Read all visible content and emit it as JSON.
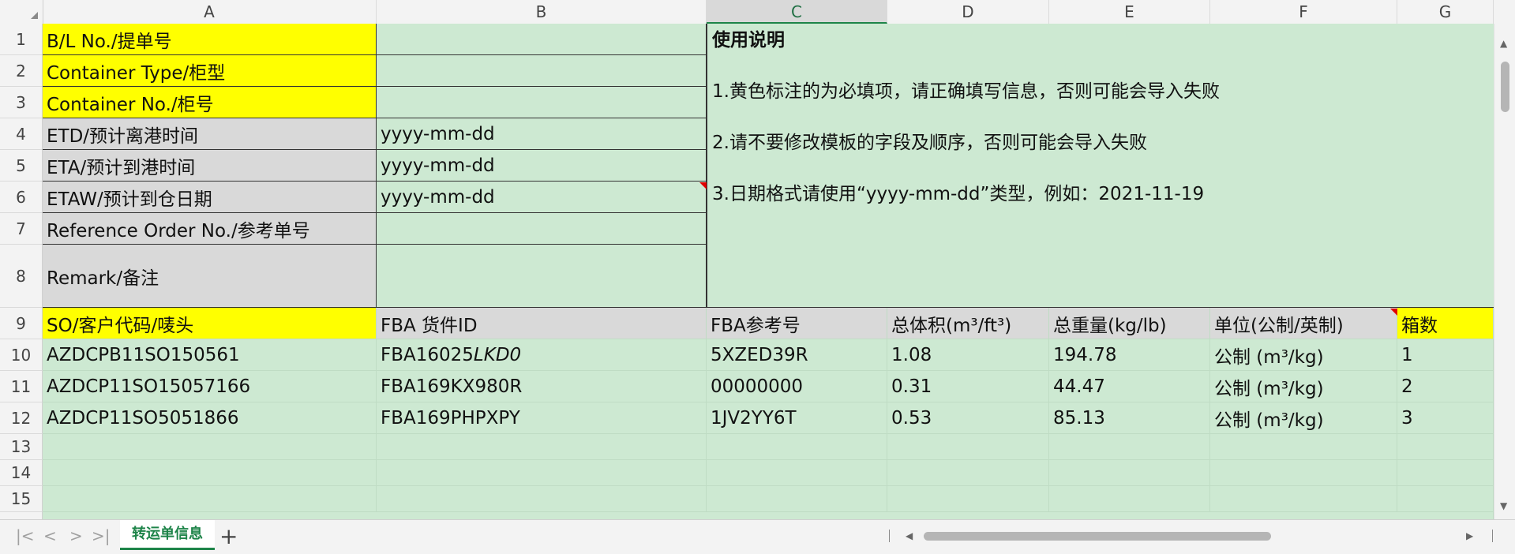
{
  "columns": [
    "A",
    "B",
    "C",
    "D",
    "E",
    "F",
    "G"
  ],
  "selected_column": "C",
  "rows": [
    "1",
    "2",
    "3",
    "4",
    "5",
    "6",
    "7",
    "8",
    "9",
    "10",
    "11",
    "12",
    "13",
    "14",
    "15"
  ],
  "header_fields": [
    {
      "label": "B/L No./提单号",
      "value": ""
    },
    {
      "label": "Container Type/柜型",
      "value": ""
    },
    {
      "label": "Container No./柜号",
      "value": ""
    },
    {
      "label": "ETD/预计离港时间",
      "value": "yyyy-mm-dd"
    },
    {
      "label": "ETA/预计到港时间",
      "value": "yyyy-mm-dd"
    },
    {
      "label": "ETAW/预计到仓日期",
      "value": "yyyy-mm-dd"
    },
    {
      "label": "Reference Order No./参考单号",
      "value": ""
    },
    {
      "label": "Remark/备注",
      "value": ""
    }
  ],
  "instructions": {
    "title": "使用说明",
    "lines": [
      "1.黄色标注的为必填项，请正确填写信息，否则可能会导入失败",
      "2.请不要修改模板的字段及顺序，否则可能会导入失败",
      "3.日期格式请使用“yyyy-mm-dd”类型，例如：2021-11-19"
    ]
  },
  "table_headers": [
    "SO/客户代码/唛头",
    " FBA 货件ID",
    "FBA参考号",
    "总体积(m³/ft³)",
    "总重量(kg/lb)",
    "单位(公制/英制)",
    "箱数"
  ],
  "table_rows": [
    {
      "so": "AZDCPB11SO150561",
      "fba_prefix": "FBA16025",
      "fba_italic": "LKD0",
      "ref": "5XZED39R",
      "volume": "1.08",
      "weight": "194.78",
      "unit": "公制 (m³/kg)",
      "boxes": "1"
    },
    {
      "so": "AZDCP11SO15057166",
      "fba_prefix": "FBA169KX980R",
      "fba_italic": "",
      "ref": "00000000",
      "volume": "0.31",
      "weight": "44.47",
      "unit": "公制 (m³/kg)",
      "boxes": "2"
    },
    {
      "so": "AZDCP11SO5051866",
      "fba_prefix": "FBA169PHPXPY",
      "fba_italic": "",
      "ref": "1JV2YY6T",
      "volume": "0.53",
      "weight": "85.13",
      "unit": "公制 (m³/kg)",
      "boxes": "3"
    }
  ],
  "sheet_tab": "转运单信息",
  "add_sheet": "+",
  "nav": {
    "first": "|<",
    "prev": "<",
    "next": ">",
    "last": ">|"
  },
  "colors": {
    "required": "#ffff00",
    "cell_green": "#cde9d2",
    "label_gray": "#d9d9d9",
    "accent": "#1e8449"
  }
}
